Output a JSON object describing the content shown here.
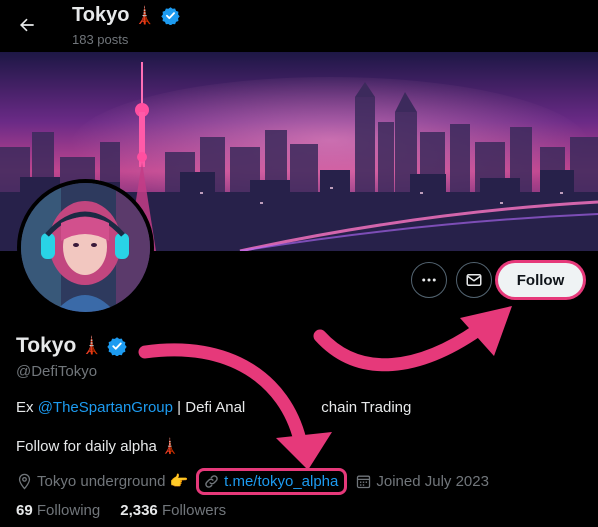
{
  "header": {
    "title": "Tokyo",
    "title_emoji": "🗼",
    "posts_count": "183 posts"
  },
  "profile": {
    "name": "Tokyo",
    "name_emoji": "🗼",
    "handle": "@DefiTokyo",
    "bio_prefix": "Ex ",
    "bio_mention": "@TheSpartanGroup",
    "bio_suffix": " | Defi Anal",
    "bio_suffix_tail": "chain Trading",
    "bio_line2": "Follow for daily alpha",
    "bio_line2_emoji": "🗼",
    "location": "Tokyo underground",
    "location_emoji": "👉",
    "link": "t.me/tokyo_alpha",
    "joined": "Joined July 2023"
  },
  "stats": {
    "following_count": "69",
    "following_label": "Following",
    "followers_count": "2,336",
    "followers_label": "Followers"
  },
  "actions": {
    "follow_label": "Follow"
  },
  "colors": {
    "accent_blue": "#1d9bf0",
    "highlight_pink": "#e6397a",
    "muted_text": "#71767b"
  },
  "icons": [
    "back-arrow-icon",
    "verified-badge-icon",
    "more-icon",
    "mail-icon",
    "location-icon",
    "link-icon",
    "calendar-icon"
  ]
}
